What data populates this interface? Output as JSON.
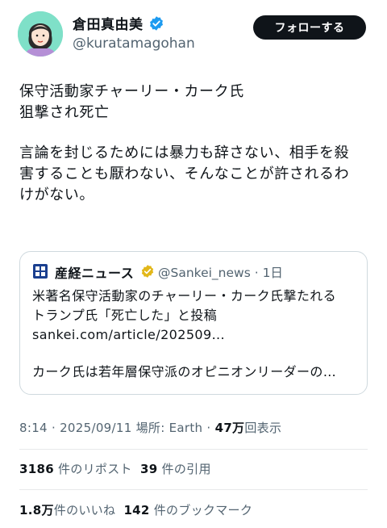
{
  "author": {
    "name": "倉田真由美",
    "handle": "@kuratamagohan",
    "verified_color": "#1d9bf0"
  },
  "follow_button": {
    "label": "フォローする"
  },
  "tweet": {
    "lines": [
      "保守活動家チャーリー・カーク氏",
      "狙撃され死亡",
      "",
      "言論を封じるためには暴力も辞さない、相手を殺",
      "害することも厭わない、そんなことが許されるわ",
      "けがない。"
    ]
  },
  "quote": {
    "name": "産経ニュース",
    "handle_time": "@Sankei_news · 1日",
    "badge_color": "#e2b719",
    "lines": [
      "米著名保守活動家のチャーリー・カーク氏撃たれる",
      "トランプ氏「死亡した」と投稿",
      "sankei.com/article/202509...",
      "",
      "カーク氏は若年層保守派のオピニオンリーダーの…"
    ]
  },
  "meta": {
    "time_date": "8:14 · 2025/09/11",
    "location": " 場所: Earth · ",
    "views_num": "47万",
    "views_label": "回表示"
  },
  "stats": {
    "reposts_num": "3186",
    "reposts_label": "件のリポスト",
    "quotes_num": "39",
    "quotes_label": "件の引用",
    "likes_num": "1.8万",
    "likes_label": "件のいいね",
    "bookmarks_num": "142",
    "bookmarks_label": "件のブックマーク"
  }
}
